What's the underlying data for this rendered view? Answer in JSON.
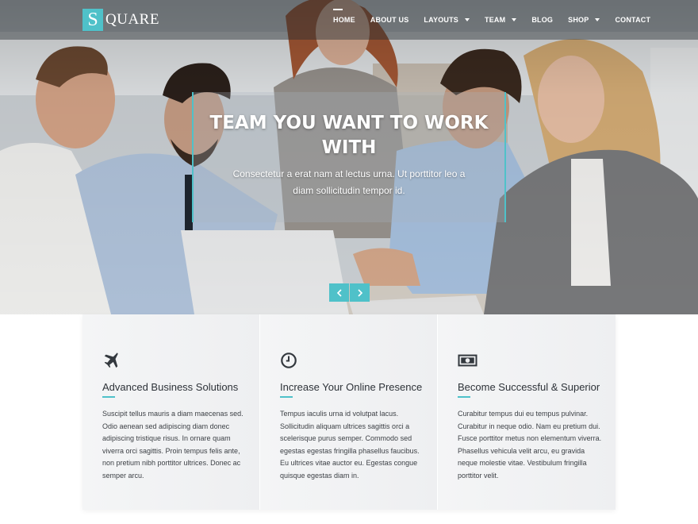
{
  "brand": {
    "logo_letter": "S",
    "logo_text": "QUARE",
    "accent_color": "#4fc1c9"
  },
  "nav": {
    "items": [
      {
        "label": "HOME",
        "active": true,
        "dropdown": false
      },
      {
        "label": "ABOUT US",
        "dropdown": false
      },
      {
        "label": "LAYOUTS",
        "dropdown": true
      },
      {
        "label": "TEAM",
        "dropdown": true
      },
      {
        "label": "BLOG",
        "dropdown": false
      },
      {
        "label": "SHOP",
        "dropdown": true
      },
      {
        "label": "CONTACT",
        "dropdown": false
      }
    ]
  },
  "hero": {
    "title": "TEAM YOU WANT TO WORK WITH",
    "text": "Consectetur a erat nam at lectus urna. Ut porttitor leo a diam sollicitudin tempor id.",
    "prev_icon": "chevron-left-icon",
    "next_icon": "chevron-right-icon"
  },
  "features": [
    {
      "icon": "airplane-icon",
      "title": "Advanced Business Solutions",
      "text": "Suscipit tellus mauris a diam maecenas sed. Odio aenean sed adipiscing diam donec adipiscing tristique risus. In ornare quam viverra orci sagittis. Proin tempus felis ante, non pretium nibh porttitor ultrices. Donec ac semper arcu."
    },
    {
      "icon": "clock-icon",
      "title": "Increase Your Online Presence",
      "text": "Tempus iaculis urna id volutpat lacus. Sollicitudin aliquam ultrices sagittis orci a scelerisque purus semper. Commodo sed egestas egestas fringilla phasellus faucibus. Eu ultrices vitae auctor eu. Egestas congue quisque egestas diam in."
    },
    {
      "icon": "money-icon",
      "title": "Become Successful & Superior",
      "text": "Curabitur tempus dui eu tempus pulvinar. Curabitur in neque odio. Nam eu pretium dui. Fusce porttitor metus non elementum viverra. Phasellus vehicula velit arcu, eu gravida neque molestie vitae. Vestibulum fringilla porttitor velit."
    }
  ]
}
